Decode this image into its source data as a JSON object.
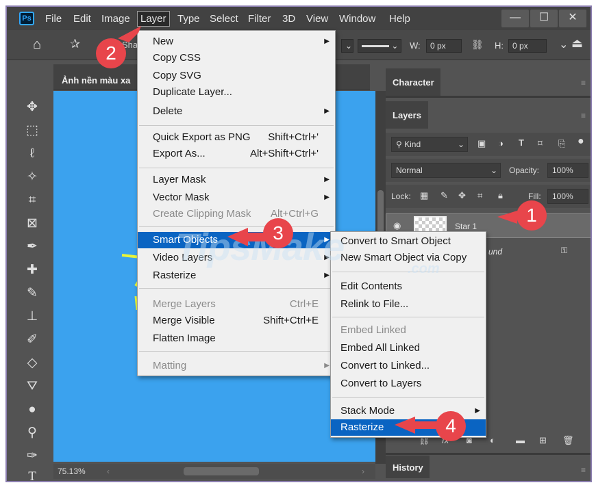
{
  "app": {
    "logo": "Ps",
    "menu": [
      "File",
      "Edit",
      "Image",
      "Layer",
      "Type",
      "Select",
      "Filter",
      "3D",
      "View",
      "Window",
      "Help"
    ],
    "active_menu": "Layer"
  },
  "window_controls": {
    "minimize": "—",
    "restore": "☐",
    "close": "✕"
  },
  "options_bar": {
    "home_icon": "home-icon",
    "tool_label_partial": "Sha",
    "w_label": "W:",
    "w_value": "0 px",
    "h_label": "H:",
    "h_value": "0 px"
  },
  "document": {
    "tab_title": "Ảnh nền màu xa",
    "zoom": "75.13%"
  },
  "layer_menu": {
    "items": [
      {
        "label": "New",
        "shortcut": "",
        "submenu": true,
        "disabled": false
      },
      {
        "label": "Copy CSS",
        "shortcut": "",
        "submenu": false,
        "disabled": false
      },
      {
        "label": "Copy SVG",
        "shortcut": "",
        "submenu": false,
        "disabled": false
      },
      {
        "label": "Duplicate Layer...",
        "shortcut": "",
        "submenu": false,
        "disabled": false
      },
      {
        "label": "Delete",
        "shortcut": "",
        "submenu": true,
        "disabled": false
      },
      {
        "label": "Quick Export as PNG",
        "shortcut": "Shift+Ctrl+'",
        "submenu": false,
        "disabled": false
      },
      {
        "label": "Export As...",
        "shortcut": "Alt+Shift+Ctrl+'",
        "submenu": false,
        "disabled": false
      },
      {
        "label": "Layer Mask",
        "shortcut": "",
        "submenu": true,
        "disabled": false
      },
      {
        "label": "Vector Mask",
        "shortcut": "",
        "submenu": true,
        "disabled": false
      },
      {
        "label": "Create Clipping Mask",
        "shortcut": "Alt+Ctrl+G",
        "submenu": false,
        "disabled": true
      },
      {
        "label": "Smart Objects",
        "shortcut": "",
        "submenu": true,
        "disabled": false,
        "highlighted": true
      },
      {
        "label": "Video Layers",
        "shortcut": "",
        "submenu": true,
        "disabled": false
      },
      {
        "label": "Rasterize",
        "shortcut": "",
        "submenu": true,
        "disabled": false
      },
      {
        "label": "Merge Layers",
        "shortcut": "Ctrl+E",
        "submenu": false,
        "disabled": true
      },
      {
        "label": "Merge Visible",
        "shortcut": "Shift+Ctrl+E",
        "submenu": false,
        "disabled": false
      },
      {
        "label": "Flatten Image",
        "shortcut": "",
        "submenu": false,
        "disabled": false
      },
      {
        "label": "Matting",
        "shortcut": "",
        "submenu": true,
        "disabled": true
      }
    ]
  },
  "smart_objects_menu": {
    "items": [
      {
        "label": "Convert to Smart Object",
        "disabled": false
      },
      {
        "label": "New Smart Object via Copy",
        "disabled": false
      },
      {
        "label": "Edit Contents",
        "disabled": false
      },
      {
        "label": "Relink to File...",
        "disabled": false
      },
      {
        "label": "Embed Linked",
        "disabled": true
      },
      {
        "label": "Embed All Linked",
        "disabled": false
      },
      {
        "label": "Convert to Linked...",
        "disabled": false
      },
      {
        "label": "Convert to Layers",
        "disabled": false
      },
      {
        "label": "Stack Mode",
        "disabled": false,
        "submenu": true
      },
      {
        "label": "Rasterize",
        "disabled": false,
        "highlighted": true
      }
    ]
  },
  "panels": {
    "character_tab": "Character",
    "layers_tab": "Layers",
    "kind_filter": "Kind",
    "blend_mode": "Normal",
    "opacity_label": "Opacity:",
    "opacity_value": "100%",
    "lock_label": "Lock:",
    "fill_label": "Fill:",
    "fill_value": "100%",
    "layers": [
      {
        "name": "Star 1",
        "selected": true
      },
      {
        "name": "und",
        "selected": false,
        "locked": true
      }
    ],
    "history_tab": "History"
  },
  "watermark": {
    "text": "TipsMake",
    "sub": ".com"
  },
  "annotations": [
    "1",
    "2",
    "3",
    "4"
  ],
  "colors": {
    "highlight": "#0a64c2",
    "canvas": "#3ba2ee",
    "badge": "#e8454b",
    "menu_bg": "#f0f0f0"
  }
}
